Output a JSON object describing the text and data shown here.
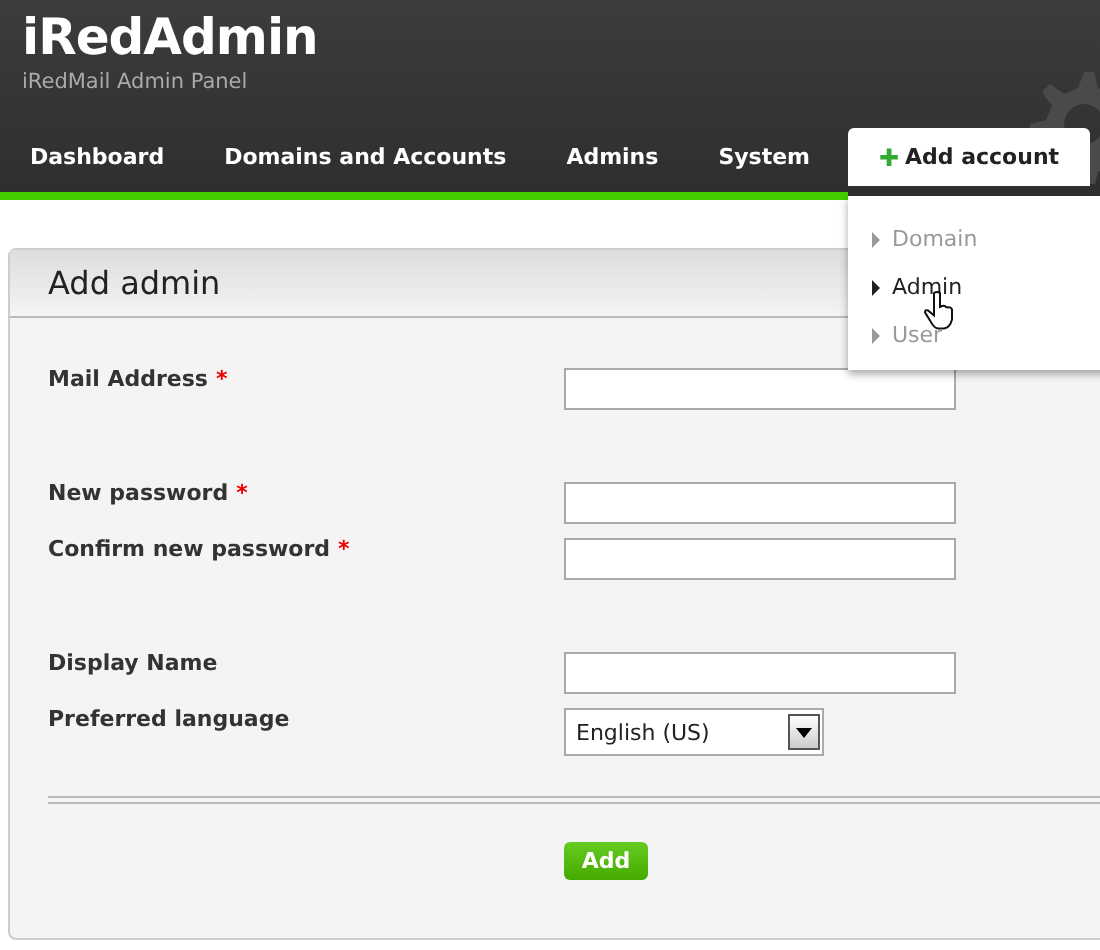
{
  "header": {
    "title": "iRedAdmin",
    "subtitle": "iRedMail Admin Panel"
  },
  "nav": [
    {
      "label": "Dashboard",
      "selected": false
    },
    {
      "label": "Domains and Accounts",
      "selected": false
    },
    {
      "label": "Admins",
      "selected": false
    },
    {
      "label": "System",
      "selected": false
    }
  ],
  "add_account": {
    "icon": "✚",
    "label": "Add account",
    "expanded": true,
    "items": [
      {
        "label": "Domain",
        "selected": false
      },
      {
        "label": "Admin",
        "selected": true
      },
      {
        "label": "User",
        "selected": false
      }
    ]
  },
  "panel": {
    "title": "Add admin",
    "groups": [
      [
        {
          "kind": "text",
          "label": "Mail Address",
          "mark": "*"
        }
      ],
      [
        {
          "kind": "text",
          "label": "New password",
          "mark": "*"
        },
        {
          "kind": "text",
          "label": "Confirm new password",
          "mark": "*"
        }
      ],
      [
        {
          "kind": "text",
          "label": "Display Name"
        },
        {
          "kind": "select",
          "label": "Preferred language",
          "value": "English (US)"
        }
      ]
    ],
    "submit": "Add"
  }
}
